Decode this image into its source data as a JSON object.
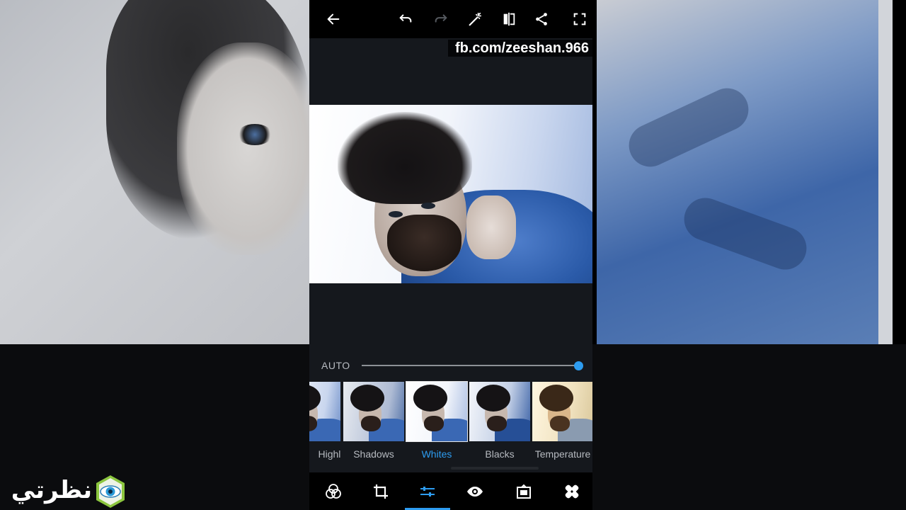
{
  "toolbar": {
    "back_icon": "arrow-left-icon",
    "undo_icon": "undo-icon",
    "redo_icon": "redo-icon",
    "auto_fix_icon": "magic-wand-icon",
    "compare_icon": "compare-icon",
    "share_icon": "share-icon",
    "fullscreen_icon": "fullscreen-icon"
  },
  "watermark": {
    "text": "fb.com/zeeshan.966"
  },
  "adjustment": {
    "auto_label": "AUTO",
    "slider_value": 1.0,
    "accent_color": "#2d9cf0"
  },
  "presets": [
    {
      "label": "Highlights"
    },
    {
      "label": "Shadows"
    },
    {
      "label": "Whites",
      "active": true
    },
    {
      "label": "Blacks"
    },
    {
      "label": "Temperature"
    }
  ],
  "bottom_nav": {
    "items": [
      {
        "icon": "looks-icon"
      },
      {
        "icon": "crop-icon"
      },
      {
        "icon": "adjust-sliders-icon",
        "active": true
      },
      {
        "icon": "eye-icon"
      },
      {
        "icon": "frame-icon"
      },
      {
        "icon": "heal-bandage-icon"
      }
    ]
  },
  "logo": {
    "text": "نظرتي",
    "icon": "eye-hexagon-icon"
  }
}
